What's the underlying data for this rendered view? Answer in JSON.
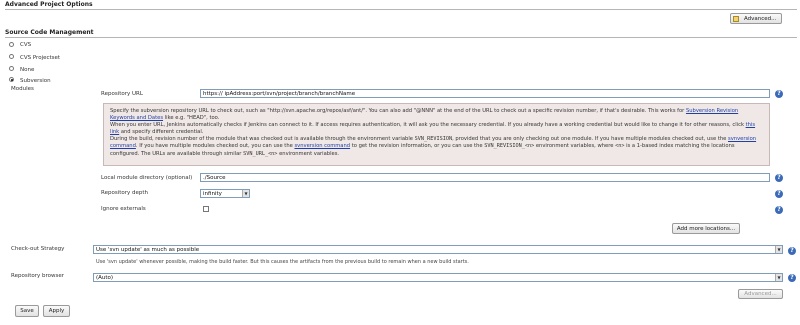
{
  "advanced_options": {
    "title": "Advanced Project Options",
    "button_label": "Advanced..."
  },
  "scm": {
    "title": "Source Code Management",
    "options": [
      {
        "label": "CVS",
        "checked": false
      },
      {
        "label": "CVS Projectset",
        "checked": false
      },
      {
        "label": "None",
        "checked": false
      },
      {
        "label": "Subversion",
        "checked": true
      }
    ],
    "modules_label": "Modules"
  },
  "repository_url": {
    "label": "Repository URL",
    "value": "https://  ipAddress:port/svn/project/branch/branchName"
  },
  "help": {
    "p1_a": "Specify the subversion repository URL to check out, such as \"http://svn.apache.org/repos/asf/ant/\". You can also add \"@NNN\" at the end of the URL to check out a specific revision number, if that's desirable. This works for ",
    "p1_link": "Subversion Revision Keywords and Dates",
    "p1_b": " like e.g. \"HEAD\", too.",
    "p2_a": "When you enter URL, Jenkins automatically checks if Jenkins can connect to it. If access requires authentication, it will ask you the necessary credential. If you already have a working credential but would like to change it for other reasons, click ",
    "p2_link": "this link",
    "p2_b": " and specify different credential.",
    "p3_a": "During the build, revision number of the module that was checked out is available through the environment variable ",
    "p3_code1": "SVN_REVISION",
    "p3_b": ", provided that you are only checking out one module. If you have multiple modules checked out, use the ",
    "p3_link1": "svnversion command",
    "p3_c": ". If you have multiple modules checked out, you can use the ",
    "p3_link2": "svnversion command",
    "p3_d": " to get the revision information, or you can use the ",
    "p3_code2": "SVN_REVISION_<n>",
    "p3_e": " environment variables, where ",
    "p3_code3": "<n>",
    "p3_f": " is a 1-based index matching the locations configured. The URLs are available through similar ",
    "p3_code4": "SVN_URL_<n>",
    "p3_g": " environment variables."
  },
  "local_module": {
    "label": "Local module directory (optional)",
    "value": "./Source"
  },
  "repository_depth": {
    "label": "Repository depth",
    "value": "infinity"
  },
  "ignore_externals": {
    "label": "Ignore externals",
    "checked": false
  },
  "add_locations_button": "Add more locations...",
  "checkout_strategy": {
    "label": "Check-out Strategy",
    "value": "Use 'svn update' as much as possible",
    "note": "Use 'svn update' whenever possible, making the build faster. But this causes the artifacts from the previous build to remain when a new build starts."
  },
  "repository_browser": {
    "label": "Repository browser",
    "value": "(Auto)"
  },
  "advanced_button_bottom": "Advanced...",
  "footer": {
    "save": "Save",
    "apply": "Apply"
  },
  "icons": {
    "help": "help-icon",
    "notepad": "notepad-icon",
    "dropdown": "chevron-down-icon"
  },
  "colors": {
    "help_icon": "#3a6ab8",
    "help_box_bg": "#f0e8e6",
    "link": "#2040a8"
  }
}
